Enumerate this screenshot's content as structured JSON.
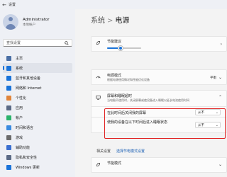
{
  "window": {
    "title": "设置",
    "back_icon": "back-arrow-icon"
  },
  "profile": {
    "name": "Administrator",
    "account_type": "本地帐户"
  },
  "search": {
    "placeholder": "查找设置"
  },
  "sidebar": {
    "items": [
      {
        "label": "主页",
        "icon": "home-icon",
        "color": "#4a6fa5"
      },
      {
        "label": "系统",
        "icon": "system-icon",
        "color": "#1a73d9",
        "active": true
      },
      {
        "label": "蓝牙和其他设备",
        "icon": "bluetooth-icon",
        "color": "#1a73d9"
      },
      {
        "label": "网络和 Internet",
        "icon": "network-icon",
        "color": "#1a73d9"
      },
      {
        "label": "个性化",
        "icon": "brush-icon",
        "color": "#e0843a"
      },
      {
        "label": "应用",
        "icon": "apps-icon",
        "color": "#5b6a85"
      },
      {
        "label": "帐户",
        "icon": "accounts-icon",
        "color": "#2bb36b"
      },
      {
        "label": "时间和语言",
        "icon": "time-language-icon",
        "color": "#3a8be0"
      },
      {
        "label": "游戏",
        "icon": "gaming-icon",
        "color": "#6b6b6b"
      },
      {
        "label": "辅助功能",
        "icon": "accessibility-icon",
        "color": "#3a6fd0"
      },
      {
        "label": "隐私和安全性",
        "icon": "shield-icon",
        "color": "#5b6a85"
      },
      {
        "label": "Windows 更新",
        "icon": "update-icon",
        "color": "#1a73d9"
      }
    ]
  },
  "breadcrumb": {
    "parent": "系统",
    "separator": ">",
    "current": "电源"
  },
  "brightness": {
    "title": "节能建议",
    "description": "",
    "slider_level": 0.4
  },
  "power_mode": {
    "title": "电源模式",
    "description": "根据电源使用情况和性能优化设备",
    "value": "平衡"
  },
  "screen_sleep": {
    "title": "屏幕和睡眠超时",
    "description": "当电脑不使用时，关闭屏幕或使设备进入睡眠以延长电池使用时间",
    "rows": [
      {
        "label": "在此时间后关闭我的屏幕",
        "value": "从不"
      },
      {
        "label": "使我的设备在以下时间后进入睡眠状态",
        "value": "从不"
      }
    ]
  },
  "related": {
    "label": "相关设置",
    "link": "选择节电模式设置"
  },
  "battery_saver": {
    "title": "节能模式",
    "description": ""
  },
  "colors": {
    "accent": "#1a73d9",
    "highlight": "#e02020"
  }
}
